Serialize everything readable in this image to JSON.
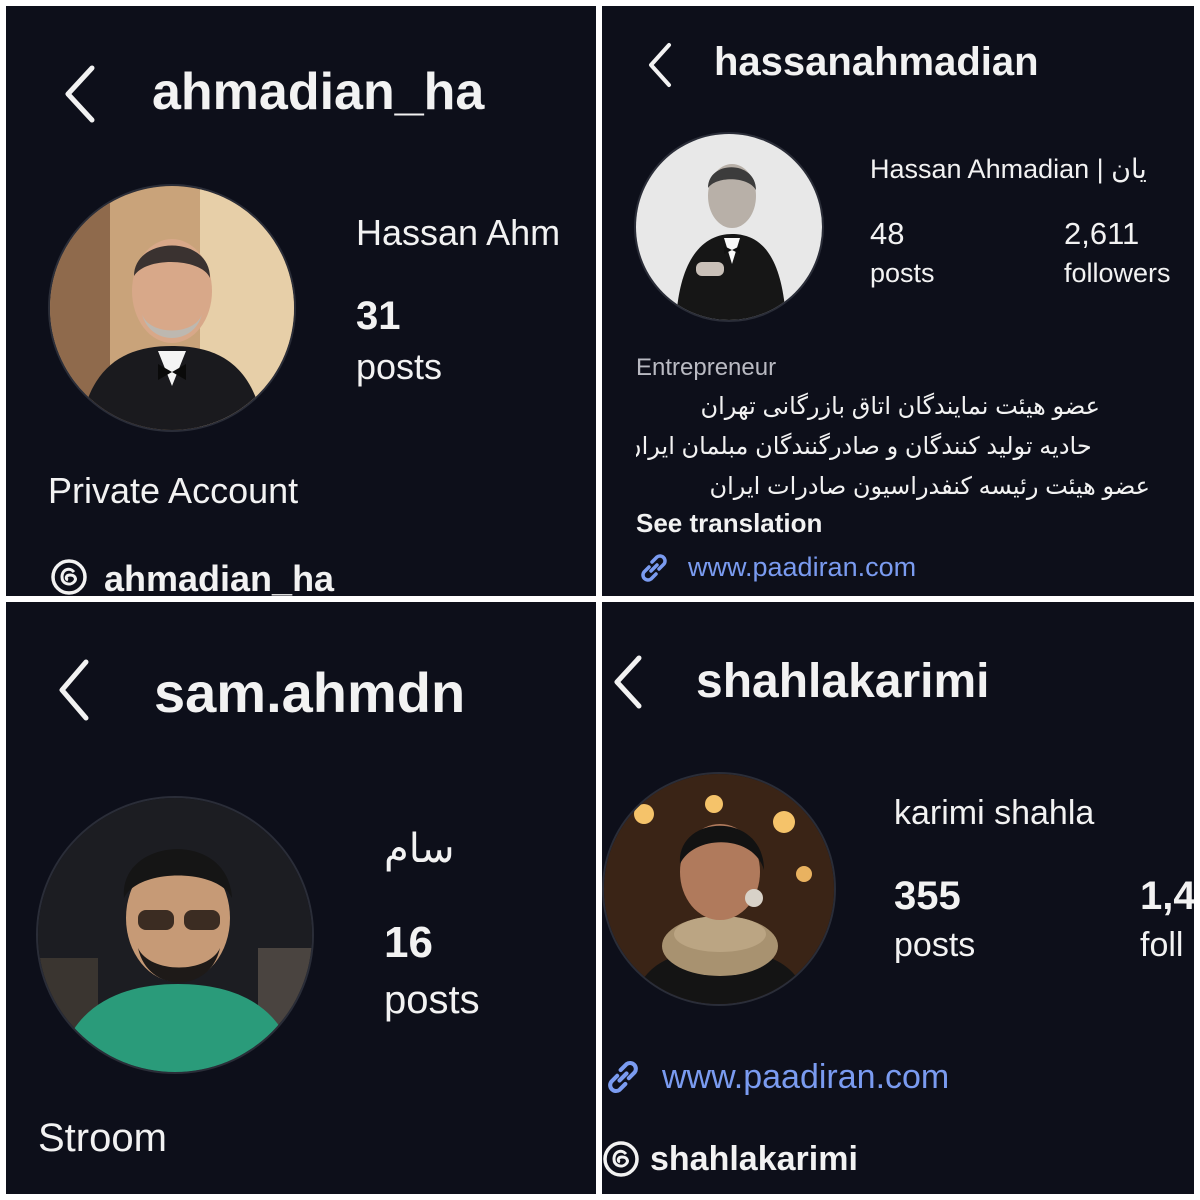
{
  "panels": [
    {
      "username": "ahmadian_ha",
      "full_name": "Hassan Ahm",
      "posts_count": "31",
      "posts_label": "posts",
      "status": "Private Account",
      "threads_handle": "ahmadian_ha"
    },
    {
      "username": "hassanahmadian",
      "full_name": "Hassan Ahmadian | یان",
      "posts_count": "48",
      "posts_label": "posts",
      "followers_count": "2,611",
      "followers_label": "followers",
      "category": "Entrepreneur",
      "bio_lines": [
        "عضو هیئت نمایندگان اتاق بازرگانی تهران",
        "حادیه تولید کنندگان و صادرگنندگان مبلمان ایران",
        "عضو هیئت رئیسه کنفدراسیون صادرات ایران"
      ],
      "see_translation": "See translation",
      "link": "www.paadiran.com"
    },
    {
      "username": "sam.ahmdn",
      "full_name": "سام",
      "posts_count": "16",
      "posts_label": "posts",
      "bio": "Stroom"
    },
    {
      "username": "shahlakarimi",
      "full_name": "karimi shahla",
      "posts_count": "355",
      "posts_label": "posts",
      "followers_count_partial": "1,4",
      "followers_label_partial": "foll",
      "link": "www.paadiran.com",
      "threads_handle": "shahlakarimi"
    }
  ],
  "colors": {
    "background": "#0d0f1a",
    "text": "#f2f2f2",
    "link": "#7a9bf0",
    "divider": "#ffffff"
  },
  "icons": [
    "back-chevron-icon",
    "threads-icon",
    "link-icon"
  ]
}
